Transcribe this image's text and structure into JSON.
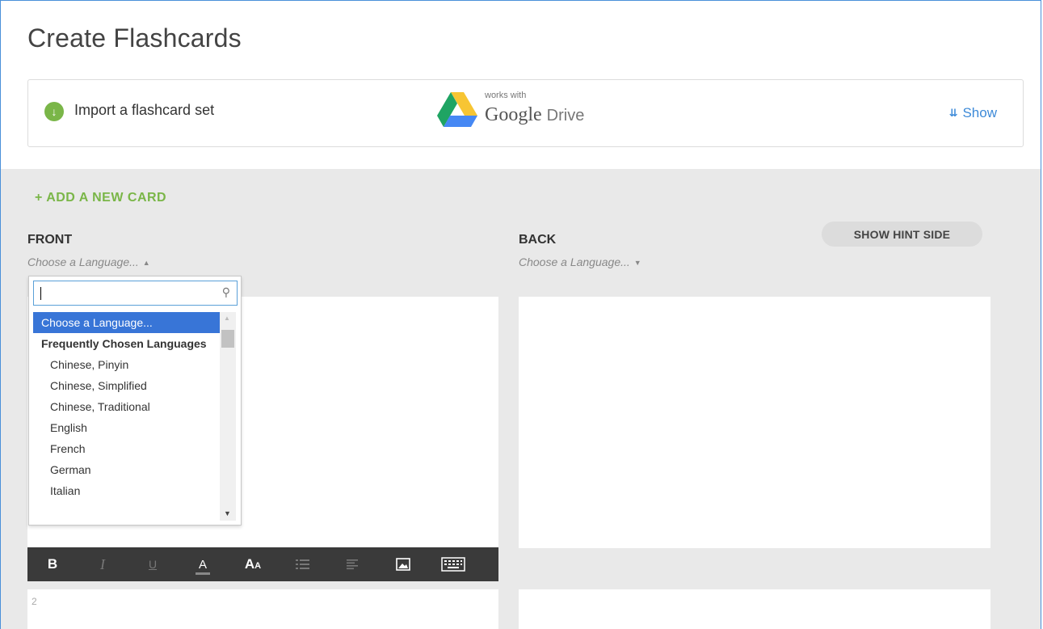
{
  "page": {
    "title": "Create Flashcards"
  },
  "import": {
    "label": "Import a flashcard set",
    "works_with": "works with",
    "google": "Google",
    "drive": "Drive",
    "show_label": "Show"
  },
  "editor": {
    "add_card_label": "+ ADD A NEW CARD",
    "front_label": "FRONT",
    "back_label": "BACK",
    "front_language": "Choose a Language...",
    "back_language": "Choose a Language...",
    "hint_button": "SHOW HINT SIDE",
    "next_card_number": "2"
  },
  "toolbar": {
    "items": [
      {
        "icon": "bold-icon",
        "glyph": "B"
      },
      {
        "icon": "italic-icon",
        "glyph": "I"
      },
      {
        "icon": "underline-icon",
        "glyph": "U"
      },
      {
        "icon": "text-color-icon",
        "glyph": "A"
      },
      {
        "icon": "font-size-icon",
        "glyph": "A"
      },
      {
        "icon": "bullet-list-icon",
        "glyph": ""
      },
      {
        "icon": "align-icon",
        "glyph": ""
      },
      {
        "icon": "image-icon",
        "glyph": ""
      },
      {
        "icon": "keyboard-icon",
        "glyph": ""
      }
    ]
  },
  "dropdown": {
    "search_value": "",
    "selected": "Choose a Language...",
    "group_label": "Frequently Chosen Languages",
    "options": [
      "Chinese, Pinyin",
      "Chinese, Simplified",
      "Chinese, Traditional",
      "English",
      "French",
      "German",
      "Italian"
    ]
  },
  "colors": {
    "accent_green": "#7ab648",
    "link_blue": "#3d8ad8",
    "selection_blue": "#3875d7",
    "toolbar_bg": "#3a3a3a"
  }
}
